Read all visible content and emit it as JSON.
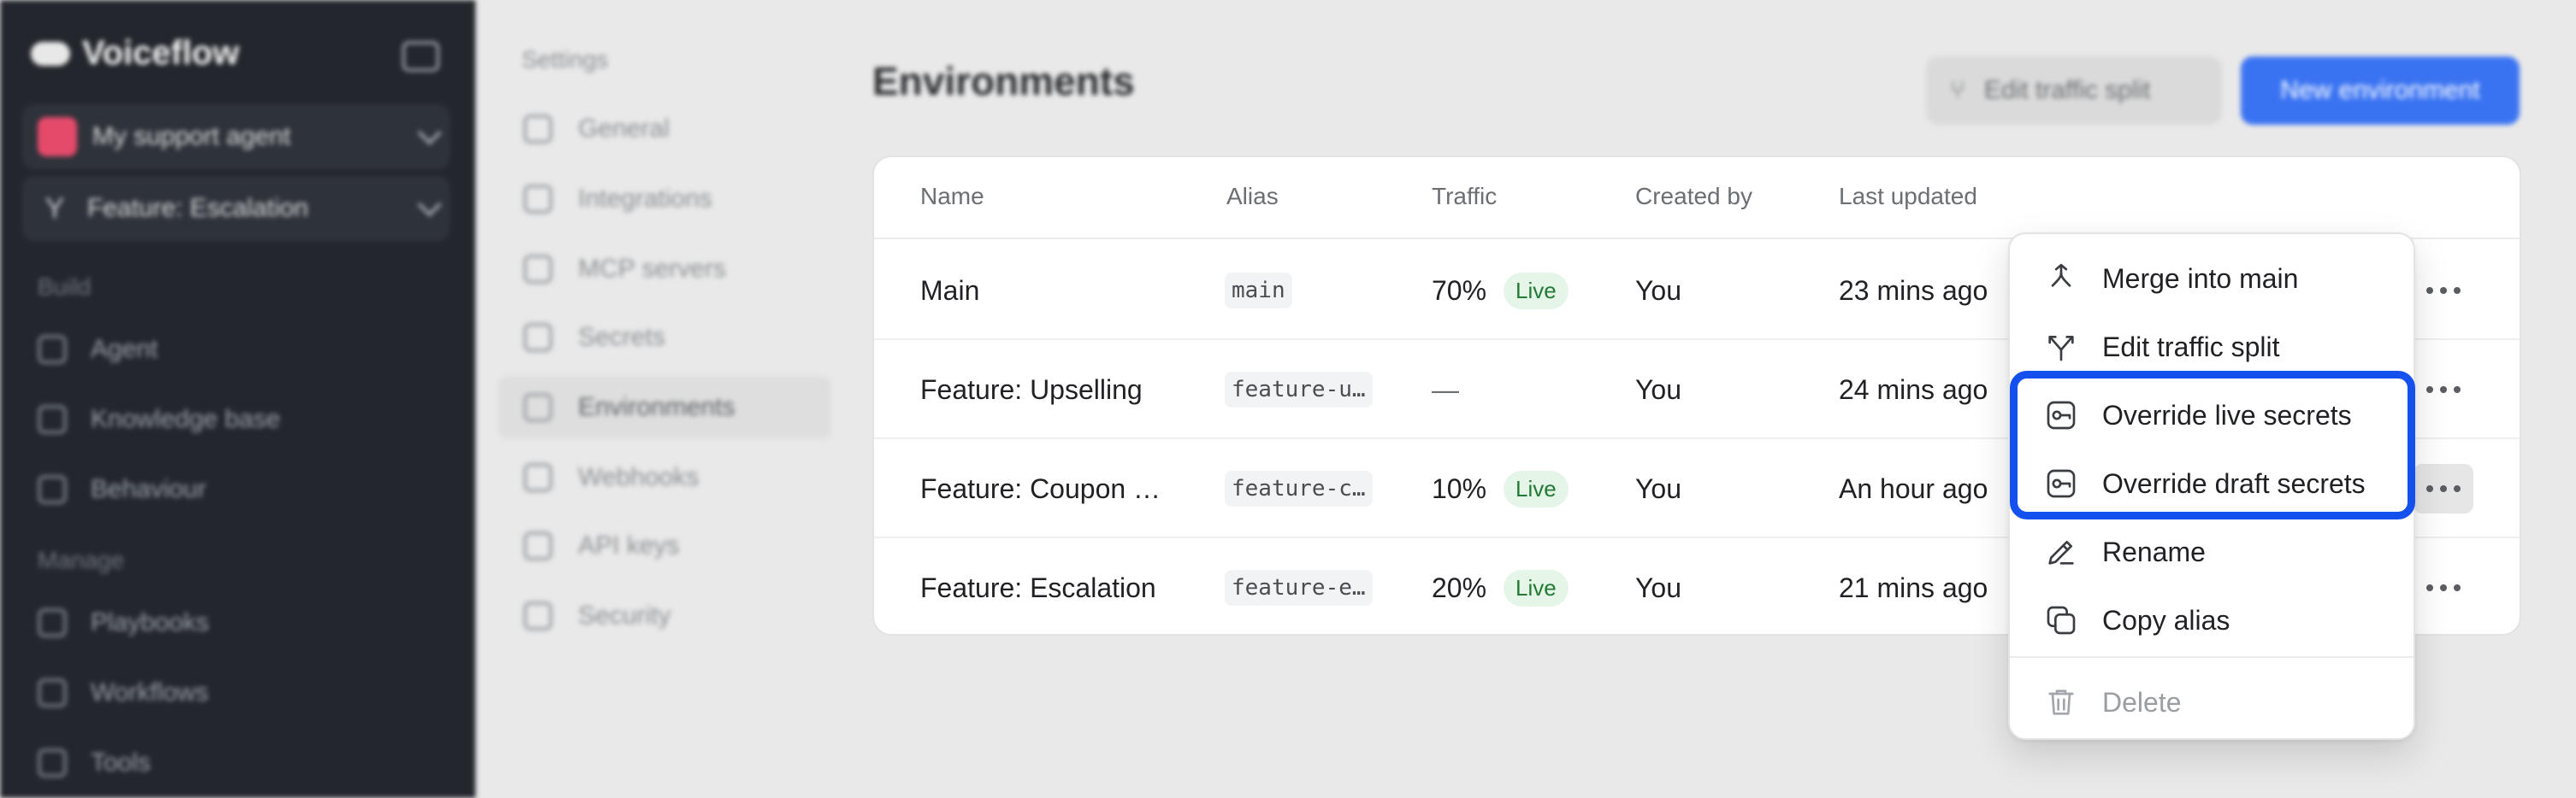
{
  "sidebar": {
    "brand": "Voiceflow",
    "agent_name": "My support agent",
    "environment_name": "Feature: Escalation",
    "sections": {
      "build": "Build",
      "manage": "Manage"
    },
    "build_items": [
      "Agent",
      "Knowledge base",
      "Behaviour"
    ],
    "manage_items": [
      "Playbooks",
      "Workflows",
      "Tools"
    ]
  },
  "settings_nav": {
    "title": "Settings",
    "items": [
      "General",
      "Integrations",
      "MCP servers",
      "Secrets",
      "Environments",
      "Webhooks",
      "API keys",
      "Security"
    ],
    "active": "Environments"
  },
  "header": {
    "title": "Environments",
    "edit_traffic_label": "Edit traffic split",
    "new_env_label": "New environment"
  },
  "table": {
    "columns": [
      "Name",
      "Alias",
      "Traffic",
      "Created by",
      "Last updated"
    ],
    "rows": [
      {
        "name": "Main",
        "alias": "main",
        "traffic": "70%",
        "live": "Live",
        "created_by": "You",
        "updated": "23 mins ago"
      },
      {
        "name": "Feature: Upselling",
        "alias": "feature-u…",
        "traffic": "—",
        "live": "",
        "created_by": "You",
        "updated": "24 mins ago"
      },
      {
        "name": "Feature: Coupon …",
        "alias": "feature-c…",
        "traffic": "10%",
        "live": "Live",
        "created_by": "You",
        "updated": "An hour ago"
      },
      {
        "name": "Feature: Escalation",
        "alias": "feature-e…",
        "traffic": "20%",
        "live": "Live",
        "created_by": "You",
        "updated": "21 mins ago"
      }
    ]
  },
  "context_menu": {
    "items": [
      {
        "label": "Merge into main",
        "icon": "merge-icon"
      },
      {
        "label": "Edit traffic split",
        "icon": "split-icon"
      },
      {
        "label": "Override live secrets",
        "icon": "key-icon"
      },
      {
        "label": "Override draft secrets",
        "icon": "key-icon"
      },
      {
        "label": "Rename",
        "icon": "pencil-icon"
      },
      {
        "label": "Copy alias",
        "icon": "copy-icon"
      },
      {
        "label": "Delete",
        "icon": "trash-icon"
      }
    ]
  },
  "colors": {
    "highlight": "#1450ee",
    "primary": "#3a73f2",
    "live_badge_bg": "#e5f5e7",
    "live_badge_text": "#237a35"
  }
}
